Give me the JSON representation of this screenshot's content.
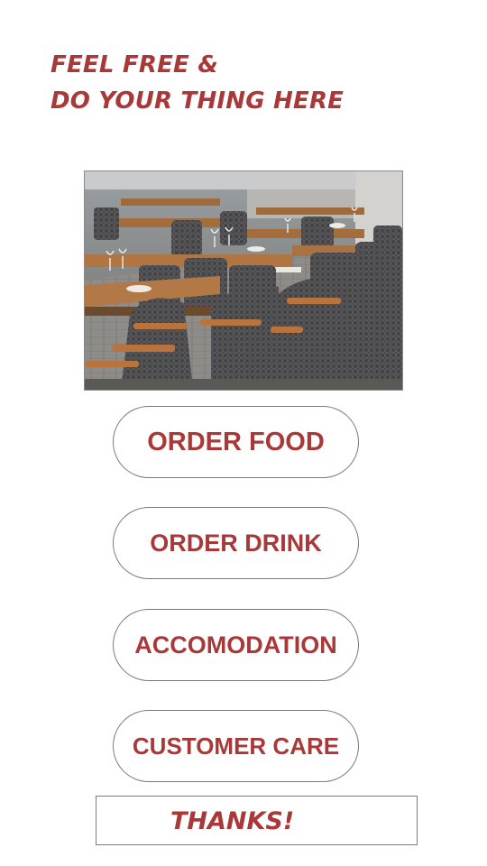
{
  "header": {
    "line1": "FEEL FREE &",
    "line2": "DO YOUR THING HERE"
  },
  "hero": {
    "alt": "Restaurant terrace with wicker chairs and set tables"
  },
  "menu": {
    "order_food": "ORDER FOOD",
    "order_drink": "ORDER DRINK",
    "accomodation": "ACCOMODATION",
    "customer_care": "CUSTOMER CARE"
  },
  "footer": {
    "thanks": "THANKS!"
  },
  "colors": {
    "accent": "#a93838",
    "border": "#7a7a7a",
    "background": "#ffffff"
  }
}
